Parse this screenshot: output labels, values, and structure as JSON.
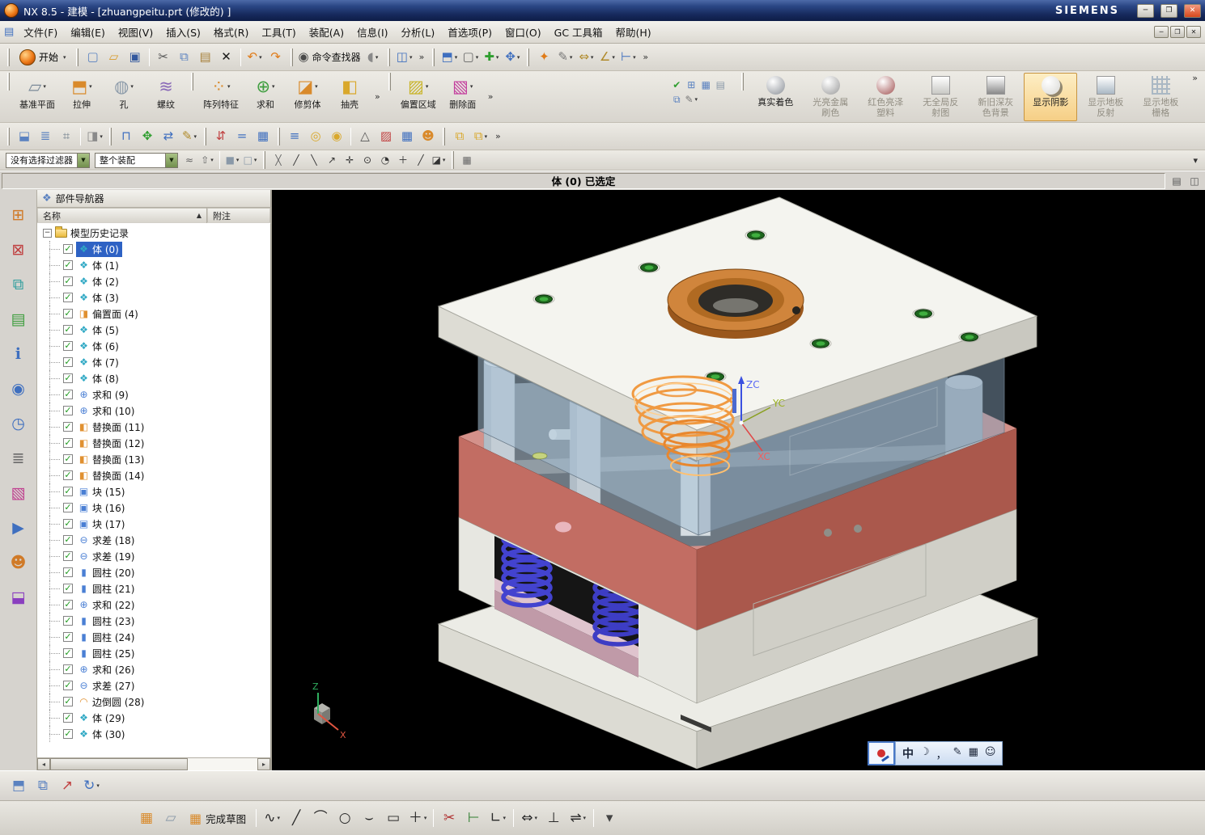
{
  "window": {
    "title": "NX 8.5 - 建模 - [zhuangpeitu.prt (修改的) ]",
    "brand": "SIEMENS",
    "min": "─",
    "restore": "❐",
    "close": "✕"
  },
  "menubar": {
    "items": [
      {
        "key": "file",
        "label": "文件(F)"
      },
      {
        "key": "edit",
        "label": "编辑(E)"
      },
      {
        "key": "view",
        "label": "视图(V)"
      },
      {
        "key": "insert",
        "label": "插入(S)"
      },
      {
        "key": "format",
        "label": "格式(R)"
      },
      {
        "key": "tools",
        "label": "工具(T)"
      },
      {
        "key": "assemblies",
        "label": "装配(A)"
      },
      {
        "key": "information",
        "label": "信息(I)"
      },
      {
        "key": "analysis",
        "label": "分析(L)"
      },
      {
        "key": "preferences",
        "label": "首选项(P)"
      },
      {
        "key": "window",
        "label": "窗口(O)"
      },
      {
        "key": "gc-toolbox",
        "label": "GC 工具箱"
      },
      {
        "key": "help",
        "label": "帮助(H)"
      }
    ],
    "min": "─",
    "restore": "❐",
    "close": "✕"
  },
  "toolbar_standard": {
    "start_label": "开始",
    "icons": [
      {
        "name": "new-file",
        "glyph": "▢",
        "color": "#5b82c0"
      },
      {
        "name": "open-file",
        "glyph": "▱",
        "color": "#d99a2b"
      },
      {
        "name": "save-file",
        "glyph": "▣",
        "color": "#33589e"
      },
      {
        "sep": true
      },
      {
        "name": "cut",
        "glyph": "✂",
        "color": "#555555"
      },
      {
        "name": "copy",
        "glyph": "⧉",
        "color": "#5b82c0"
      },
      {
        "name": "paste",
        "glyph": "▤",
        "color": "#a8823c"
      },
      {
        "name": "delete",
        "glyph": "✕",
        "color": "#1a1a1a"
      },
      {
        "sep": true
      },
      {
        "name": "undo",
        "glyph": "↶",
        "color": "#e07b18",
        "caret": true
      },
      {
        "name": "redo",
        "glyph": "↷",
        "color": "#e07b18"
      },
      {
        "grip": true
      },
      {
        "name": "command-finder",
        "glyph": "◉",
        "color": "#4a4a4a",
        "label": "命令查找器"
      },
      {
        "name": "touch-mode",
        "glyph": "◖",
        "color": "#8a8a8a",
        "caret": true
      },
      {
        "grip": true
      },
      {
        "name": "window-layout",
        "glyph": "◫",
        "color": "#3f6fbf",
        "caret": true
      },
      {
        "name": "overflow-a",
        "glyph": "»",
        "overflow": true
      },
      {
        "grip": true
      },
      {
        "name": "display-cube",
        "glyph": "⬒",
        "color": "#3f6fbf",
        "caret": true
      },
      {
        "name": "show-hide",
        "glyph": "▢",
        "color": "#666666",
        "caret": true
      },
      {
        "name": "zoom",
        "glyph": "✚",
        "color": "#2f9e2f",
        "caret": true
      },
      {
        "name": "pan",
        "glyph": "✥",
        "color": "#3f6fbf",
        "caret": true
      },
      {
        "grip": true
      },
      {
        "name": "visual-effects",
        "glyph": "✦",
        "color": "#e07b18"
      },
      {
        "name": "edit-section",
        "glyph": "✎",
        "color": "#777777",
        "caret": true
      },
      {
        "name": "measure-distance",
        "glyph": "⇔",
        "color": "#b08a2a",
        "caret": true
      },
      {
        "name": "measure-angle",
        "glyph": "∠",
        "color": "#b08a2a",
        "caret": true
      },
      {
        "name": "ruler",
        "glyph": "⊢",
        "color": "#3f6fbf",
        "caret": true
      },
      {
        "name": "overflow-b",
        "glyph": "»",
        "overflow": true
      }
    ]
  },
  "feature_toolbar": {
    "buttons": [
      {
        "name": "datum-plane",
        "label": "基准平面",
        "glyph": "▱",
        "color": "#7a8a99",
        "caret": true
      },
      {
        "name": "extrude",
        "label": "拉伸",
        "glyph": "⬒",
        "color": "#d98a2b",
        "caret": true
      },
      {
        "name": "hole",
        "label": "孔",
        "glyph": "◍",
        "color": "#8a99a8",
        "caret": true
      },
      {
        "name": "thread",
        "label": "螺纹",
        "glyph": "≋",
        "color": "#8a6ab8"
      },
      {
        "grip": true
      },
      {
        "name": "pattern-feature",
        "label": "阵列特征",
        "glyph": "⁘",
        "color": "#d98a2b",
        "caret": true
      },
      {
        "name": "unite-feature",
        "label": "求和",
        "glyph": "⊕",
        "color": "#3f9e3f",
        "caret": true
      },
      {
        "name": "trim-body",
        "label": "修剪体",
        "glyph": "◪",
        "color": "#d98a2b",
        "caret": true
      },
      {
        "name": "shell",
        "label": "抽壳",
        "glyph": "◧",
        "color": "#d9a82b"
      },
      {
        "overflow": true
      },
      {
        "grip": true
      },
      {
        "name": "offset-region",
        "label": "偏置区域",
        "glyph": "▨",
        "color": "#c9b52b",
        "caret": true
      },
      {
        "name": "delete-face",
        "label": "删除面",
        "glyph": "▧",
        "color": "#c43f9e",
        "caret": true
      },
      {
        "overflow": true
      }
    ],
    "misc_icons": [
      {
        "name": "validate",
        "glyph": "✔",
        "color": "#2f9e2f"
      },
      {
        "name": "datum-csys",
        "glyph": "⊞",
        "color": "#5b82c0"
      },
      {
        "name": "spreadsheet",
        "glyph": "▦",
        "color": "#5b82c0"
      },
      {
        "name": "annotation",
        "glyph": "▤",
        "color": "#8a99a8"
      },
      {
        "name": "wave-link",
        "glyph": "⧉",
        "color": "#5b82c0"
      },
      {
        "name": "edit-feature",
        "glyph": "✎",
        "color": "#777777",
        "caret": true
      }
    ],
    "render_buttons": [
      {
        "name": "true-shading",
        "label": "真实着色",
        "icon": "sphere",
        "color": "#8a8f96",
        "state": "normal"
      },
      {
        "name": "brushed-metal",
        "label": "光亮金属刷色",
        "icon": "sphere",
        "color": "#9a9a9a",
        "state": "disabled"
      },
      {
        "name": "red-plastic",
        "label": "红色亮泽塑料",
        "icon": "sphere",
        "color": "#a05050",
        "state": "disabled"
      },
      {
        "name": "no-global-reflection",
        "label": "无全局反射图",
        "icon": "flat",
        "color": "#c8c8c4",
        "state": "disabled"
      },
      {
        "name": "gray-background",
        "label": "新旧深灰色背景",
        "icon": "flat",
        "color": "#8a8a8a",
        "state": "disabled"
      },
      {
        "name": "show-shadow",
        "label": "显示阴影",
        "icon": "sphere-shadow",
        "color": "#d8d8d4",
        "state": "selected"
      },
      {
        "name": "floor-reflection",
        "label": "显示地板反射",
        "icon": "flat",
        "color": "#aab8c4",
        "state": "disabled"
      },
      {
        "name": "floor-grid",
        "label": "显示地板栅格",
        "icon": "grid",
        "color": "#aab8c4",
        "state": "disabled"
      }
    ],
    "overflow_end": "»"
  },
  "toolbar_row3": {
    "icons": [
      {
        "name": "object-display",
        "glyph": "⬓",
        "color": "#5b82c0"
      },
      {
        "name": "show-and-hide",
        "glyph": "≣",
        "color": "#5b82c0"
      },
      {
        "name": "layer-settings",
        "glyph": "⌗",
        "color": "#6a7a88"
      },
      {
        "sep": true
      },
      {
        "name": "render-style",
        "glyph": "◨",
        "color": "#8a8a8a",
        "caret": true
      },
      {
        "grip": true
      },
      {
        "name": "assembly-constraints",
        "glyph": "⊓",
        "color": "#3f6fbf"
      },
      {
        "name": "move-component",
        "glyph": "✥",
        "color": "#2f9e2f"
      },
      {
        "name": "mirror-assembly",
        "glyph": "⇄",
        "color": "#3f6fbf"
      },
      {
        "name": "edit-sequence",
        "glyph": "✎",
        "color": "#b08a2a",
        "caret": true
      },
      {
        "grip": true
      },
      {
        "name": "interpart-link",
        "glyph": "⇵",
        "color": "#c04040"
      },
      {
        "name": "expression",
        "glyph": "=",
        "color": "#3f6fbf"
      },
      {
        "name": "tool-spreadsheet",
        "glyph": "▦",
        "color": "#3f6fbf"
      },
      {
        "grip": true
      },
      {
        "name": "datum-display",
        "glyph": "≡",
        "color": "#3f6fbf"
      },
      {
        "name": "snap-ring",
        "glyph": "◎",
        "color": "#d9a82b"
      },
      {
        "name": "bolt-circle",
        "glyph": "◉",
        "color": "#d9a82b"
      },
      {
        "sep": true
      },
      {
        "name": "triangle-mesh",
        "glyph": "△",
        "color": "#555555"
      },
      {
        "name": "section-face",
        "glyph": "▨",
        "color": "#c04040"
      },
      {
        "name": "grid-face",
        "glyph": "▦",
        "color": "#3f6fbf"
      },
      {
        "name": "user-groups",
        "glyph": "☻",
        "color": "#d98a2b"
      },
      {
        "grip": true
      },
      {
        "name": "copy-face",
        "glyph": "⧉",
        "color": "#d9a82b"
      },
      {
        "name": "paste-face",
        "glyph": "⧉",
        "color": "#d9a82b",
        "caret": true
      },
      {
        "name": "overflow-c",
        "glyph": "»",
        "overflow": true
      }
    ]
  },
  "selection_bar": {
    "filter_value": "没有选择过滤器",
    "scope_value": "整个装配",
    "icons": [
      {
        "name": "select-chain",
        "glyph": "≈",
        "color": "#666666"
      },
      {
        "name": "up-one-level",
        "glyph": "⇧",
        "color": "#666666",
        "caret": true
      },
      {
        "sep": true
      },
      {
        "name": "solid-body-filter",
        "glyph": "■",
        "color": "#8a99a8",
        "caret": true
      },
      {
        "name": "region-filter",
        "glyph": "□",
        "color": "#8a99a8",
        "caret": true
      },
      {
        "grip": true
      },
      {
        "name": "snap-point-toggle",
        "glyph": "╳",
        "color": "#666666"
      },
      {
        "name": "snap-endpoint",
        "glyph": "╱",
        "color": "#333333"
      },
      {
        "name": "snap-midpoint",
        "glyph": "╲",
        "color": "#333333"
      },
      {
        "name": "snap-control-point",
        "glyph": "↗",
        "color": "#333333"
      },
      {
        "name": "snap-intersection",
        "glyph": "✛",
        "color": "#333333"
      },
      {
        "name": "snap-arc-center",
        "glyph": "⊙",
        "color": "#333333"
      },
      {
        "name": "snap-quadrant",
        "glyph": "◔",
        "color": "#333333"
      },
      {
        "name": "snap-existing-point",
        "glyph": "＋",
        "color": "#333333"
      },
      {
        "name": "snap-point-on-curve",
        "glyph": "╱",
        "color": "#333333"
      },
      {
        "name": "snap-point-on-face",
        "glyph": "◪",
        "color": "#333333",
        "caret": true
      },
      {
        "grip": true
      },
      {
        "name": "grid-snap",
        "glyph": "▦",
        "color": "#666666"
      }
    ]
  },
  "status_bar": {
    "message": "体 (0) 已选定",
    "icons": [
      {
        "name": "status-panel",
        "glyph": "▤",
        "color": "#555555"
      },
      {
        "name": "status-window",
        "glyph": "◫",
        "color": "#555555"
      }
    ]
  },
  "resource_bar": {
    "icons": [
      {
        "name": "assembly-navigator",
        "glyph": "⊞",
        "color": "#d07a28"
      },
      {
        "name": "constraint-navigator",
        "glyph": "⊠",
        "color": "#c04040"
      },
      {
        "name": "part-navigator",
        "glyph": "⧉",
        "color": "#2f9e9e"
      },
      {
        "name": "reuse-library",
        "glyph": "▤",
        "color": "#3f9e3f"
      },
      {
        "name": "hd3d-tools",
        "glyph": "ℹ",
        "color": "#3f6fbf"
      },
      {
        "name": "web-browser",
        "glyph": "◉",
        "color": "#3f6fbf"
      },
      {
        "name": "history",
        "glyph": "◷",
        "color": "#3f6fbf"
      },
      {
        "name": "system-materials",
        "glyph": "≣",
        "color": "#6a6a6a"
      },
      {
        "name": "process-studio",
        "glyph": "▧",
        "color": "#c04090"
      },
      {
        "name": "manufacturing-wizard",
        "glyph": "▶",
        "color": "#3f6fbf"
      },
      {
        "name": "roles",
        "glyph": "☻",
        "color": "#d07a28"
      },
      {
        "name": "system-scenes",
        "glyph": "⬓",
        "color": "#8a3fbf"
      }
    ]
  },
  "part_navigator": {
    "title": "部件导航器",
    "col_name": "名称",
    "col_note": "附注",
    "sort_glyph": "▲",
    "root_label": "模型历史记录",
    "type_icons": {
      "body": {
        "glyph": "❖",
        "color": "#2fa8c4"
      },
      "offset-face": {
        "glyph": "◨",
        "color": "#e09030"
      },
      "unite": {
        "glyph": "⊕",
        "color": "#4a7fd4"
      },
      "replace-face": {
        "glyph": "◧",
        "color": "#e09030"
      },
      "block": {
        "glyph": "▣",
        "color": "#4a7fd4"
      },
      "subtract": {
        "glyph": "⊖",
        "color": "#4a7fd4"
      },
      "cylinder": {
        "glyph": "▮",
        "color": "#4a7fd4"
      },
      "edge-blend": {
        "glyph": "◠",
        "color": "#e09030"
      }
    },
    "items": [
      {
        "label": "体 (0)",
        "type": "body",
        "checked": true,
        "selected": true
      },
      {
        "label": "体 (1)",
        "type": "body",
        "checked": true
      },
      {
        "label": "体 (2)",
        "type": "body",
        "checked": true
      },
      {
        "label": "体 (3)",
        "type": "body",
        "checked": true
      },
      {
        "label": "偏置面 (4)",
        "type": "offset-face",
        "checked": true
      },
      {
        "label": "体 (5)",
        "type": "body",
        "checked": true
      },
      {
        "label": "体 (6)",
        "type": "body",
        "checked": true
      },
      {
        "label": "体 (7)",
        "type": "body",
        "checked": true
      },
      {
        "label": "体 (8)",
        "type": "body",
        "checked": true
      },
      {
        "label": "求和 (9)",
        "type": "unite",
        "checked": true
      },
      {
        "label": "求和 (10)",
        "type": "unite",
        "checked": true
      },
      {
        "label": "替换面 (11)",
        "type": "replace-face",
        "checked": true
      },
      {
        "label": "替换面 (12)",
        "type": "replace-face",
        "checked": true
      },
      {
        "label": "替换面 (13)",
        "type": "replace-face",
        "checked": true
      },
      {
        "label": "替换面 (14)",
        "type": "replace-face",
        "checked": true
      },
      {
        "label": "块 (15)",
        "type": "block",
        "checked": true
      },
      {
        "label": "块 (16)",
        "type": "block",
        "checked": true
      },
      {
        "label": "块 (17)",
        "type": "block",
        "checked": true
      },
      {
        "label": "求差 (18)",
        "type": "subtract",
        "checked": true
      },
      {
        "label": "求差 (19)",
        "type": "subtract",
        "checked": true
      },
      {
        "label": "圆柱 (20)",
        "type": "cylinder",
        "checked": true
      },
      {
        "label": "圆柱 (21)",
        "type": "cylinder",
        "checked": true
      },
      {
        "label": "求和 (22)",
        "type": "unite",
        "checked": true
      },
      {
        "label": "圆柱 (23)",
        "type": "cylinder",
        "checked": true
      },
      {
        "label": "圆柱 (24)",
        "type": "cylinder",
        "checked": true
      },
      {
        "label": "圆柱 (25)",
        "type": "cylinder",
        "checked": true
      },
      {
        "label": "求和 (26)",
        "type": "unite",
        "checked": true
      },
      {
        "label": "求差 (27)",
        "type": "subtract",
        "checked": true
      },
      {
        "label": "边倒圆 (28)",
        "type": "edge-blend",
        "checked": true
      },
      {
        "label": "体 (29)",
        "type": "body",
        "checked": true
      },
      {
        "label": "体 (30)",
        "type": "body",
        "checked": true
      }
    ]
  },
  "panel_footer": {
    "icons": [
      {
        "name": "timestamp-order",
        "glyph": "⬒",
        "color": "#5b82c0"
      },
      {
        "name": "panel-windows",
        "glyph": "⧉",
        "color": "#5b82c0"
      },
      {
        "name": "export-panel",
        "glyph": "↗",
        "color": "#c04040"
      },
      {
        "name": "refresh",
        "glyph": "↻",
        "color": "#3f6fbf",
        "caret": true
      }
    ]
  },
  "sketch_toolbar": {
    "task_icons": [
      {
        "name": "sketch-task",
        "glyph": "▦",
        "color": "#d98a2b"
      },
      {
        "name": "sketch-plane",
        "glyph": "▱",
        "color": "#8a99a8"
      }
    ],
    "finish_label": "完成草图",
    "tools": [
      {
        "name": "profile",
        "glyph": "∿",
        "color": "#2a2a2a",
        "caret": true
      },
      {
        "name": "line",
        "glyph": "╱",
        "color": "#2a2a2a"
      },
      {
        "name": "arc",
        "glyph": "⌒",
        "color": "#2a2a2a"
      },
      {
        "name": "circle",
        "glyph": "○",
        "color": "#2a2a2a"
      },
      {
        "name": "fillet",
        "glyph": "⌣",
        "color": "#2a2a2a"
      },
      {
        "name": "rectangle",
        "glyph": "▭",
        "color": "#2a2a2a"
      },
      {
        "name": "point",
        "glyph": "＋",
        "color": "#2a2a2a",
        "caret": true
      },
      {
        "sep": true
      },
      {
        "name": "quick-trim",
        "glyph": "✂",
        "color": "#b03030"
      },
      {
        "name": "quick-extend",
        "glyph": "⊢",
        "color": "#2f7e2f"
      },
      {
        "name": "make-corner",
        "glyph": "∟",
        "color": "#2a2a2a",
        "caret": true
      },
      {
        "sep": true
      },
      {
        "name": "rapid-dimension",
        "glyph": "⇔",
        "color": "#2a2a2a",
        "caret": true
      },
      {
        "name": "geometric-constraints",
        "glyph": "⊥",
        "color": "#2a2a2a"
      },
      {
        "name": "make-symmetric",
        "glyph": "⇌",
        "color": "#2a2a2a",
        "caret": true
      },
      {
        "sep": true
      },
      {
        "name": "more-tools",
        "glyph": "▾",
        "color": "#444444"
      }
    ]
  },
  "viewport": {
    "axis_zc": "ZC",
    "axis_yc": "YC",
    "axis_xc": "XC",
    "triad_z": "Z",
    "triad_x": "X"
  },
  "ime_bar": {
    "mode": "中",
    "items": [
      {
        "name": "ime-shape",
        "glyph": "☽"
      },
      {
        "name": "ime-punctuation",
        "glyph": "，"
      },
      {
        "name": "ime-pen",
        "glyph": "✎"
      },
      {
        "name": "ime-keyboard",
        "glyph": "▦"
      },
      {
        "name": "ime-smiley",
        "glyph": "☺"
      }
    ]
  }
}
